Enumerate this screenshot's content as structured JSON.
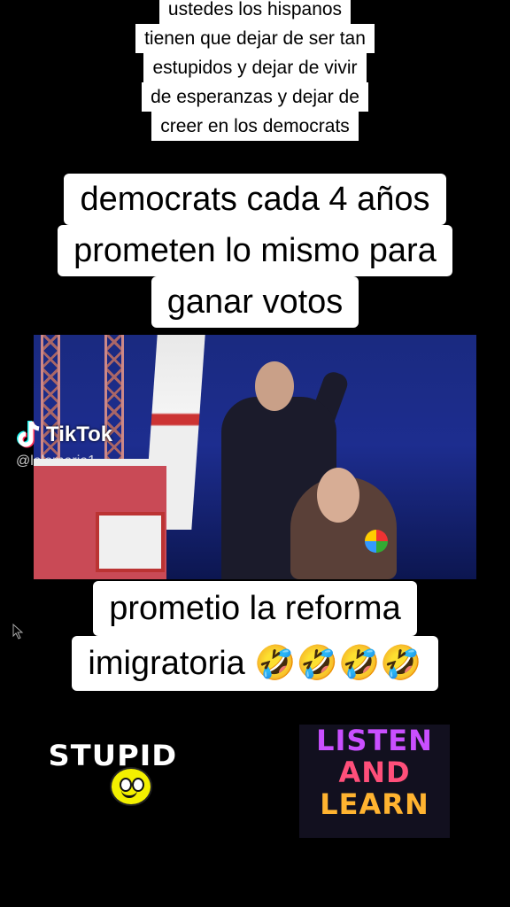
{
  "top_caption": {
    "lines": [
      "ustedes los hispanos",
      "tienen que dejar de ser tan",
      "estupidos y dejar de vivir",
      "de esperanzas y dejar de",
      "creer en los democrats"
    ]
  },
  "main_caption": {
    "lines": [
      "democrats cada 4 años",
      "prometen lo mismo para",
      "ganar votos"
    ]
  },
  "bottom_caption": {
    "lines": [
      "prometio la reforma",
      "imigratoria 🤣🤣🤣🤣"
    ]
  },
  "watermark": {
    "brand": "TikTok",
    "handle": "@lalomaria1"
  },
  "video": {
    "icon": "univision-logo-icon"
  },
  "stickers": {
    "stupid": "STUPID",
    "listen_lines": [
      "LISTEN",
      "AND",
      "LEARN"
    ],
    "colors": {
      "listen": "#c94fff",
      "and": "#ff4f7a",
      "learn": "#ffb330",
      "smiley": "#f3f000"
    }
  }
}
